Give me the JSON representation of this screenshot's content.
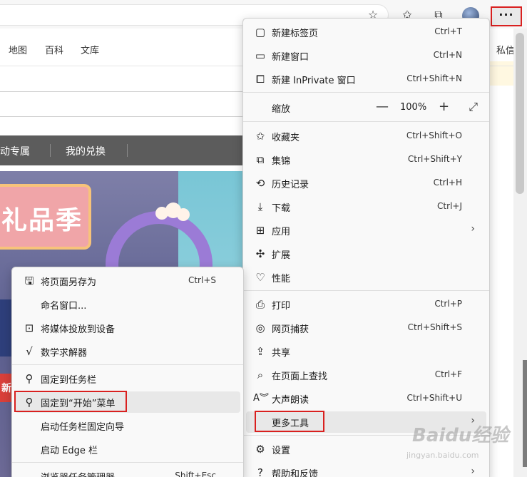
{
  "browser": {
    "more_label": "···"
  },
  "page": {
    "nav_links": [
      "地图",
      "百科",
      "文库"
    ],
    "nav_right": "私信",
    "gray_links": [
      "动专属",
      "我的兑换"
    ],
    "banner_text": "礼品季",
    "red_text": "新"
  },
  "main_menu": {
    "items": [
      {
        "icon": "new-tab-icon",
        "label": "新建标签页",
        "shortcut": "Ctrl+T"
      },
      {
        "icon": "new-window-icon",
        "label": "新建窗口",
        "shortcut": "Ctrl+N"
      },
      {
        "icon": "inprivate-icon",
        "label": "新建 InPrivate 窗口",
        "shortcut": "Ctrl+Shift+N"
      },
      {
        "icon": "",
        "label": "缩放",
        "zoom_minus": "—",
        "zoom_value": "100%",
        "zoom_plus": "+",
        "zoom_full": "⤢"
      },
      {
        "icon": "favorites-icon",
        "label": "收藏夹",
        "shortcut": "Ctrl+Shift+O"
      },
      {
        "icon": "collections-icon",
        "label": "集锦",
        "shortcut": "Ctrl+Shift+Y"
      },
      {
        "icon": "history-icon",
        "label": "历史记录",
        "shortcut": "Ctrl+H"
      },
      {
        "icon": "download-icon",
        "label": "下载",
        "shortcut": "Ctrl+J"
      },
      {
        "icon": "apps-icon",
        "label": "应用",
        "chevron": "›"
      },
      {
        "icon": "extensions-icon",
        "label": "扩展"
      },
      {
        "icon": "performance-icon",
        "label": "性能"
      },
      {
        "icon": "print-icon",
        "label": "打印",
        "shortcut": "Ctrl+P"
      },
      {
        "icon": "web-capture-icon",
        "label": "网页捕获",
        "shortcut": "Ctrl+Shift+S"
      },
      {
        "icon": "share-icon",
        "label": "共享"
      },
      {
        "icon": "find-icon",
        "label": "在页面上查找",
        "shortcut": "Ctrl+F"
      },
      {
        "icon": "read-aloud-icon",
        "label": "大声朗读",
        "shortcut": "Ctrl+Shift+U"
      },
      {
        "icon": "",
        "label": "更多工具",
        "chevron": "›"
      },
      {
        "icon": "settings-icon",
        "label": "设置"
      },
      {
        "icon": "help-icon",
        "label": "帮助和反馈",
        "chevron": "›"
      }
    ]
  },
  "sub_menu": {
    "items": [
      {
        "icon": "save-page-icon",
        "label": "将页面另存为",
        "shortcut": "Ctrl+S"
      },
      {
        "icon": "",
        "label": "命名窗口..."
      },
      {
        "icon": "cast-icon",
        "label": "将媒体投放到设备"
      },
      {
        "icon": "math-solver-icon",
        "label": "数学求解器"
      },
      {
        "icon": "pin-icon",
        "label": "固定到任务栏"
      },
      {
        "icon": "pin-icon",
        "label": "固定到“开始”菜单"
      },
      {
        "icon": "",
        "label": "启动任务栏固定向导"
      },
      {
        "icon": "",
        "label": "启动 Edge 栏"
      },
      {
        "icon": "",
        "label": "浏览器任务管理器",
        "shortcut": "Shift+Esc"
      }
    ]
  },
  "watermark": {
    "brand": "Baidu经验",
    "url": "jingyan.baidu.com"
  },
  "colors": {
    "highlight_box": "#d9201f",
    "menu_bg": "#f9f9f9"
  }
}
